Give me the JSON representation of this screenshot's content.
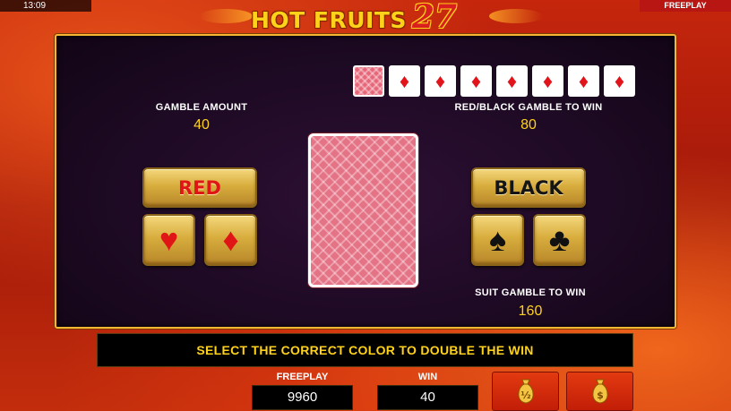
{
  "status_bar": {
    "time": "13:09",
    "mode": "FREEPLAY"
  },
  "logo": {
    "text": "HOT FRUITS",
    "number": "27"
  },
  "history": {
    "cards": [
      {
        "kind": "back",
        "icon": "card-back"
      },
      {
        "kind": "diamond",
        "icon": "diamond-icon",
        "glyph": "♦"
      },
      {
        "kind": "diamond",
        "icon": "diamond-icon",
        "glyph": "♦"
      },
      {
        "kind": "diamond",
        "icon": "diamond-icon",
        "glyph": "♦"
      },
      {
        "kind": "diamond",
        "icon": "diamond-icon",
        "glyph": "♦"
      },
      {
        "kind": "diamond",
        "icon": "diamond-icon",
        "glyph": "♦"
      },
      {
        "kind": "diamond",
        "icon": "diamond-icon",
        "glyph": "♦"
      },
      {
        "kind": "diamond",
        "icon": "diamond-icon",
        "glyph": "♦"
      }
    ]
  },
  "gamble_amount": {
    "label": "GAMBLE AMOUNT",
    "value": "40"
  },
  "red_black_win": {
    "label": "RED/BLACK GAMBLE TO WIN",
    "value": "80"
  },
  "suit_win": {
    "label": "SUIT GAMBLE TO WIN",
    "value": "160"
  },
  "buttons": {
    "red": "RED",
    "black": "BLACK",
    "hearts": "♥",
    "diamonds": "♦",
    "spades": "♠",
    "clubs": "♣"
  },
  "message": "SELECT THE CORRECT COLOR TO DOUBLE THE WIN",
  "meters": {
    "freeplay": {
      "label": "FREEPLAY",
      "value": "9960"
    },
    "win": {
      "label": "WIN",
      "value": "40"
    }
  },
  "collect_buttons": {
    "half": {
      "icon": "money-bag-half-icon",
      "label": "½"
    },
    "full": {
      "icon": "money-bag-icon",
      "label": "$"
    }
  },
  "colors": {
    "accent_gold": "#ffd21a",
    "red_suit": "#e01616",
    "panel_border": "#f7b733"
  }
}
